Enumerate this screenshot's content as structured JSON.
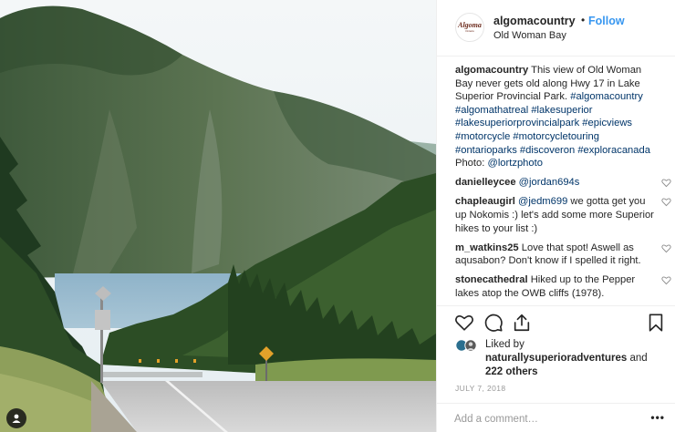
{
  "post": {
    "photo": {
      "alt_subject": "",
      "user_tag_icon": "person-icon"
    },
    "header": {
      "handle": "algomacountry",
      "dot": "•",
      "follow_label": "Follow",
      "location": "Old Woman Bay",
      "avatar_logo_text": "Algoma",
      "avatar_logo_sub": "Ontario"
    },
    "caption": {
      "username": "algomacountry",
      "text": "This view of Old Woman Bay never gets old along Hwy 17 in Lake Superior Provincial Park.",
      "hashtags": "#algomacountry #algomathatreal #lakesuperior #lakesuperiorprovincialpark #epicviews #motorcycle #motorcycletouring #ontarioparks #discoveron #exploracanada",
      "photo_credit_label": "Photo:",
      "photo_credit_handle": "@lortzphoto"
    },
    "comments": [
      {
        "username": "danielleycee",
        "mention": "@jordan694s",
        "text": ""
      },
      {
        "username": "chapleaugirl",
        "mention": "@jedm699",
        "text": "we gotta get you up Nokomis :) let's add some more Superior hikes to your list :)"
      },
      {
        "username": "m_watkins25",
        "mention": "",
        "text": "Love that spot! Aswell as aqusabon? Don't know if I spelled it right."
      },
      {
        "username": "stonecathedral",
        "mention": "",
        "text": "Hiked up to the Pepper lakes atop the OWB cliffs (1978)."
      }
    ],
    "actions": {
      "like_icon": "heart-icon",
      "comment_icon": "comment-icon",
      "share_icon": "share-icon",
      "save_icon": "bookmark-icon"
    },
    "likes": {
      "prefix": "Liked by",
      "liker": "naturallysuperioradventures",
      "conjunction": "and",
      "others": "222 others"
    },
    "date": "JULY 7, 2018",
    "add_comment": {
      "placeholder": "Add a comment…",
      "more_label": "•••"
    },
    "colors": {
      "accent": "#3897f0",
      "text": "#262626",
      "muted": "#999999",
      "tag": "#003569",
      "divider": "#efefef"
    }
  }
}
